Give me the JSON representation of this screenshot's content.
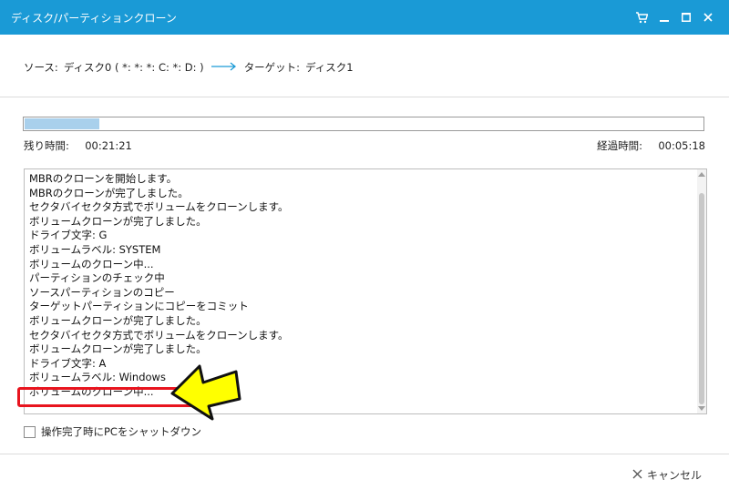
{
  "window": {
    "title": "ディスク/パーティションクローン",
    "accent_color": "#1a9ad6"
  },
  "titlebar_buttons": [
    "cart-icon",
    "minimize-icon",
    "maximize-icon",
    "close-icon"
  ],
  "route": {
    "source_label": "ソース:",
    "source_value": "ディスク0 ( *: *: *: C: *: D: )",
    "target_label": "ターゲット:",
    "target_value": "ディスク1"
  },
  "progress": {
    "fraction": 0.11,
    "remaining_label": "残り時間:",
    "remaining_value": "00:21:21",
    "elapsed_label": "経過時間:",
    "elapsed_value": "00:05:18"
  },
  "log": [
    "MBRのクローンを開始します。",
    "MBRのクローンが完了しました。",
    "セクタバイセクタ方式でボリュームをクローンします。",
    "ボリュームクローンが完了しました。",
    "ドライブ文字: G",
    "ボリュームラベル: SYSTEM",
    "ボリュームのクローン中...",
    "パーティションのチェック中",
    "ソースパーティションのコピー",
    "ターゲットパーティションにコピーをコミット",
    "ボリュームクローンが完了しました。",
    "セクタバイセクタ方式でボリュームをクローンします。",
    "ボリュームクローンが完了しました。",
    "ドライブ文字: A",
    "ボリュームラベル: Windows",
    "ボリュームのクローン中..."
  ],
  "shutdown_option": {
    "label": "操作完了時にPCをシャットダウン",
    "checked": false
  },
  "cancel": {
    "label": "キャンセル"
  },
  "annotation": {
    "highlight_color": "#e8141e",
    "arrow_color": "#ffff00"
  }
}
